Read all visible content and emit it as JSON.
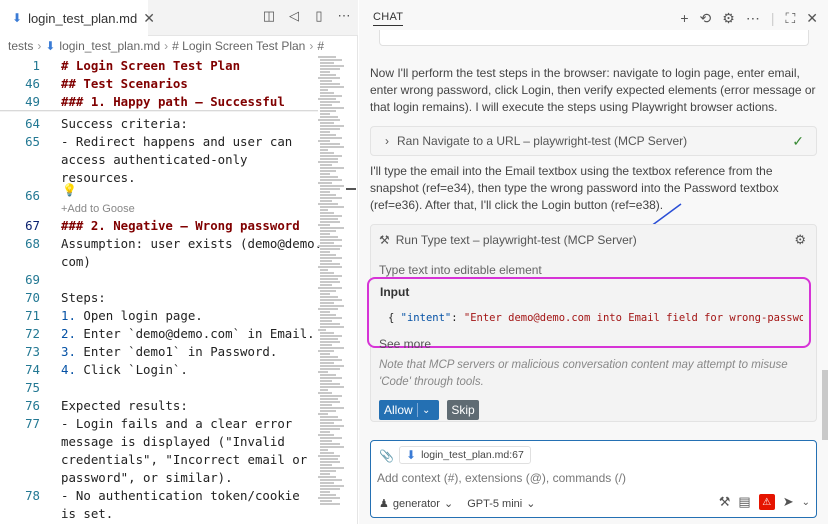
{
  "editor": {
    "tab_label": "login_test_plan.md",
    "tab_close": "✕",
    "breadcrumb": [
      "tests",
      "login_test_plan.md",
      "# Login Screen Test Plan",
      "#"
    ],
    "lines": [
      {
        "n": "1",
        "text": "# Login Screen Test Plan",
        "kind": "h"
      },
      {
        "n": "46",
        "text": "## Test Scenarios",
        "kind": "h"
      },
      {
        "n": "49",
        "text": "### 1. Happy path — Successful",
        "kind": "h"
      },
      {
        "n": "64",
        "text": "Success criteria:",
        "kind": "t"
      },
      {
        "n": "65",
        "text": "- Redirect happens and user can",
        "kind": "t"
      },
      {
        "n": "",
        "text": "access authenticated-only",
        "kind": "t"
      },
      {
        "n": "",
        "text": "resources.",
        "kind": "t"
      },
      {
        "n": "66",
        "text": "",
        "kind": "t"
      },
      {
        "n": "67",
        "text": "### 2. Negative — Wrong password",
        "kind": "h"
      },
      {
        "n": "68",
        "text": "Assumption: user exists (demo@demo.",
        "kind": "t"
      },
      {
        "n": "",
        "text": "com)",
        "kind": "t"
      },
      {
        "n": "69",
        "text": "",
        "kind": "t"
      },
      {
        "n": "70",
        "text": "Steps:",
        "kind": "t"
      },
      {
        "n": "71",
        "text": "1. Open login page.",
        "kind": "o"
      },
      {
        "n": "72",
        "text": "2. Enter `demo@demo.com` in Email.",
        "kind": "o"
      },
      {
        "n": "73",
        "text": "3. Enter `demo1` in Password.",
        "kind": "o"
      },
      {
        "n": "74",
        "text": "4. Click `Login`.",
        "kind": "o"
      },
      {
        "n": "75",
        "text": "",
        "kind": "t"
      },
      {
        "n": "76",
        "text": "Expected results:",
        "kind": "t"
      },
      {
        "n": "77",
        "text": "- Login fails and a clear error",
        "kind": "t"
      },
      {
        "n": "",
        "text": "message is displayed (\"Invalid",
        "kind": "t"
      },
      {
        "n": "",
        "text": "credentials\", \"Incorrect email or",
        "kind": "t"
      },
      {
        "n": "",
        "text": "password\", or similar).",
        "kind": "t"
      },
      {
        "n": "78",
        "text": "- No authentication token/cookie",
        "kind": "t"
      },
      {
        "n": "",
        "text": "is set.",
        "kind": "t"
      }
    ],
    "add_to_goose": "+Add to Goose"
  },
  "chat": {
    "title": "CHAT",
    "para1": "Now I'll perform the test steps in the browser: navigate to login page, enter email, enter wrong password, click Login, then verify expected elements (error message or that login remains). I will execute the steps using Playwright browser actions.",
    "ran_label": "Ran Navigate to a URL – playwright-test (MCP Server)",
    "para2": "I'll type the email into the Email textbox using the textbox reference from the snapshot (ref=e34), then type the wrong password into the Password textbox (ref=e36). After that, I'll click the Login button (ref=e38).",
    "tool": {
      "title": "Run Type text – playwright-test (MCP Server)",
      "description": "Type text into editable element",
      "input_label": "Input",
      "input_key": "\"intent\"",
      "input_value": "\"Enter demo@demo.com into Email field for wrong-password",
      "see_more": "See more",
      "note": "Note that MCP servers or malicious conversation content may attempt to misuse 'Code' through tools.",
      "allow": "Allow",
      "skip": "Skip"
    },
    "composer": {
      "context_file": "login_test_plan.md:67",
      "placeholder": "Add context (#), extensions (@), commands (/)",
      "mode": "generator",
      "model": "GPT-5 mini"
    }
  },
  "colors": {
    "accent": "#2470b3",
    "highlight": "#d633d6",
    "success": "#388a34",
    "warning": "#e51400"
  }
}
